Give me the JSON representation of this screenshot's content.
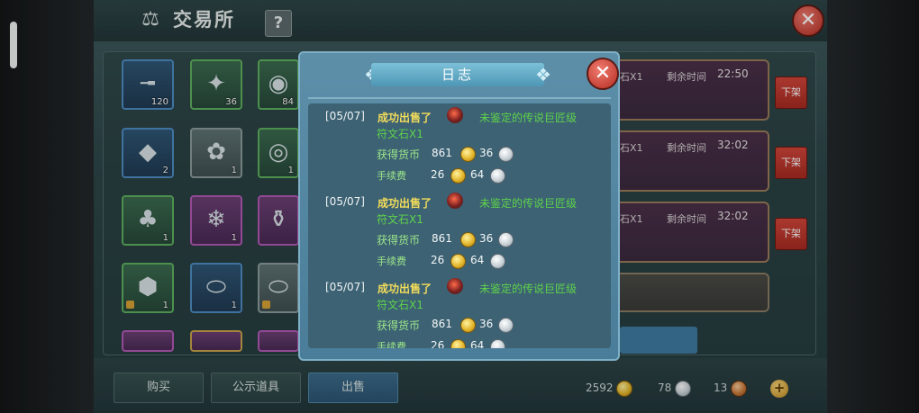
{
  "window": {
    "title": "交易所",
    "help_label": "?",
    "close_label": "✕"
  },
  "grid_items": [
    {
      "qty": "120",
      "icon": "flintlock-gun-icon"
    },
    {
      "qty": "36",
      "icon": "crystal-cluster-icon"
    },
    {
      "qty": "84",
      "icon": "jade-orb-icon"
    },
    {
      "qty": "2",
      "icon": "blue-gem-shard-icon"
    },
    {
      "qty": "1",
      "icon": "flower-bouquet-icon"
    },
    {
      "qty": "1",
      "icon": "steamed-bun-basket-icon"
    },
    {
      "qty": "1",
      "icon": "coin-sack-icon"
    },
    {
      "qty": "1",
      "icon": "ice-crystal-icon"
    },
    {
      "qty": "",
      "icon": "potion-bottle-icon"
    },
    {
      "qty": "1",
      "icon": "turtle-icon"
    },
    {
      "qty": "1",
      "icon": "stone-disc-icon"
    },
    {
      "qty": "",
      "icon": "stone-disc-icon"
    }
  ],
  "listings": [
    {
      "count": "石X1",
      "time_label": "剩余时间",
      "time": "22:50",
      "delist": "下架"
    },
    {
      "count": "石X1",
      "time_label": "剩余时间",
      "time": "32:02",
      "delist": "下架"
    },
    {
      "count": "石X1",
      "time_label": "剩余时间",
      "time": "32:02",
      "delist": "下架"
    }
  ],
  "tabs": {
    "buy": "购买",
    "public": "公示道具",
    "sell": "出售"
  },
  "currency": {
    "gold": "2592",
    "silver": "78",
    "copper": "13",
    "add": "+"
  },
  "log": {
    "title": "日志",
    "close_label": "✕",
    "entries": [
      {
        "date": "[05/07]",
        "action": "成功出售了",
        "item": "未鉴定的传说巨匠级符文石X1",
        "earn_label": "获得货币",
        "earn_gold": "861",
        "earn_silver": "36",
        "fee_label": "手续费",
        "fee_gold": "26",
        "fee_silver": "64"
      },
      {
        "date": "[05/07]",
        "action": "成功出售了",
        "item": "未鉴定的传说巨匠级符文石X1",
        "earn_label": "获得货币",
        "earn_gold": "861",
        "earn_silver": "36",
        "fee_label": "手续费",
        "fee_gold": "26",
        "fee_silver": "64"
      },
      {
        "date": "[05/07]",
        "action": "成功出售了",
        "item": "未鉴定的传说巨匠级符文石X1",
        "earn_label": "获得货币",
        "earn_gold": "861",
        "earn_silver": "36",
        "fee_label": "手续费",
        "fee_gold": "26",
        "fee_silver": "64"
      }
    ]
  },
  "colors": {
    "sold_text": "#f3dc5a",
    "item_text": "#5fd24a",
    "close_red": "#c0392b",
    "modal_blue": "#4a7d99"
  }
}
